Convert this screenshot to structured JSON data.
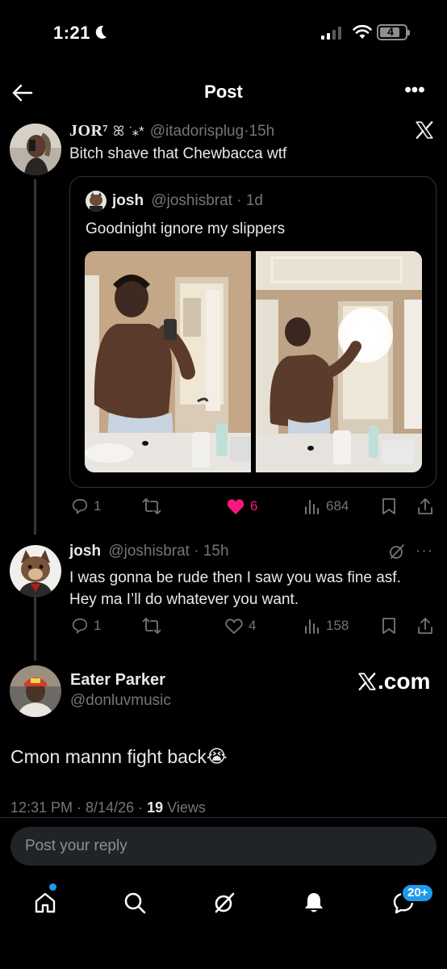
{
  "status_bar": {
    "time": "1:21",
    "battery": "4"
  },
  "header": {
    "title": "Post",
    "more": "•••"
  },
  "post1": {
    "name": "JOR⁷",
    "name_deco": "ꕤ ͘ ⁎*",
    "handle": "@itadorisplug",
    "time": "15h",
    "text": "Bitch shave that Chewbacca wtf",
    "quote": {
      "name": "josh",
      "handle": "@joshisbrat",
      "time": "1d",
      "text": "Goodnight ignore my slippers"
    },
    "actions": {
      "replies": "1",
      "likes": "6",
      "views": "684"
    }
  },
  "post2": {
    "name": "josh",
    "handle": "@joshisbrat",
    "time": "15h",
    "more": "···",
    "text": "I was gonna be rude then I saw you was fine asf. Hey ma I’ll do whatever you want.",
    "actions": {
      "replies": "1",
      "likes": "4",
      "views": "158"
    }
  },
  "main_post": {
    "name": "Eater Parker",
    "handle": "@donluvmusic",
    "badge": ".com",
    "text": "Cmon mannn fight back",
    "emoji": "😭",
    "time": "12:31 PM",
    "date": "8/14/26",
    "views_count": "19",
    "views_label": "Views"
  },
  "reply": {
    "placeholder": "Post your reply"
  },
  "nav": {
    "messages_badge": "20+"
  },
  "colors": {
    "accent": "#1d9bf0",
    "like": "#f91880",
    "muted": "#71767b",
    "background": "#000000"
  }
}
